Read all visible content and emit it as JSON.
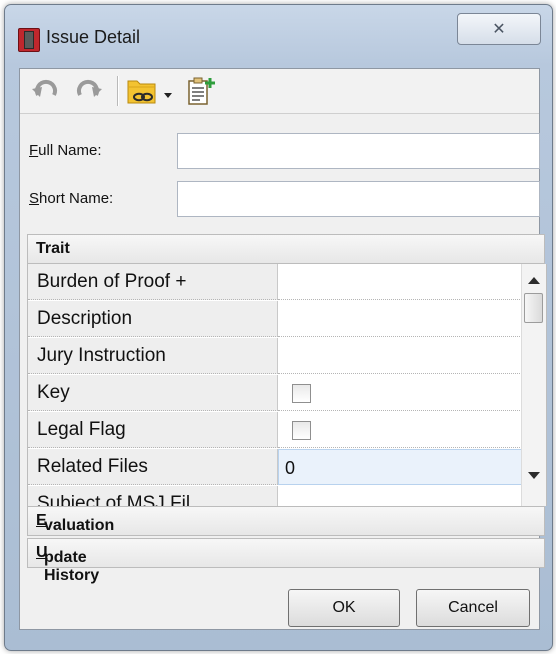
{
  "window": {
    "title": "Issue Detail",
    "close_glyph": "✕"
  },
  "toolbar": {
    "icons": [
      "undo-icon",
      "redo-icon",
      "link-folder-icon",
      "dropdown-arrow-icon",
      "add-clipboard-icon"
    ]
  },
  "form": {
    "full_name": {
      "label": "Full Name:",
      "accesskey": "F",
      "value": ""
    },
    "short_name": {
      "label": "Short Name:",
      "accesskey": "S",
      "value": ""
    }
  },
  "sections": {
    "trait": "Trait",
    "evaluation": "Evaluation",
    "update_history": "Update History"
  },
  "traits": [
    {
      "name": "Burden of Proof +",
      "value": ""
    },
    {
      "name": "Description",
      "value": ""
    },
    {
      "name": "Jury Instruction",
      "value": ""
    },
    {
      "name": "Key",
      "type": "checkbox",
      "checked": false
    },
    {
      "name": "Legal Flag",
      "type": "checkbox",
      "checked": false
    },
    {
      "name": "Related Files",
      "value": "0"
    },
    {
      "name": "Subject of MSJ Fil",
      "value": ""
    }
  ],
  "buttons": {
    "ok": "OK",
    "cancel": "Cancel"
  },
  "colors": {
    "frame": "#b7c8dd",
    "accent_red": "#c0272d",
    "folder_yellow": "#f3c331",
    "add_green": "#2e9d3c"
  }
}
